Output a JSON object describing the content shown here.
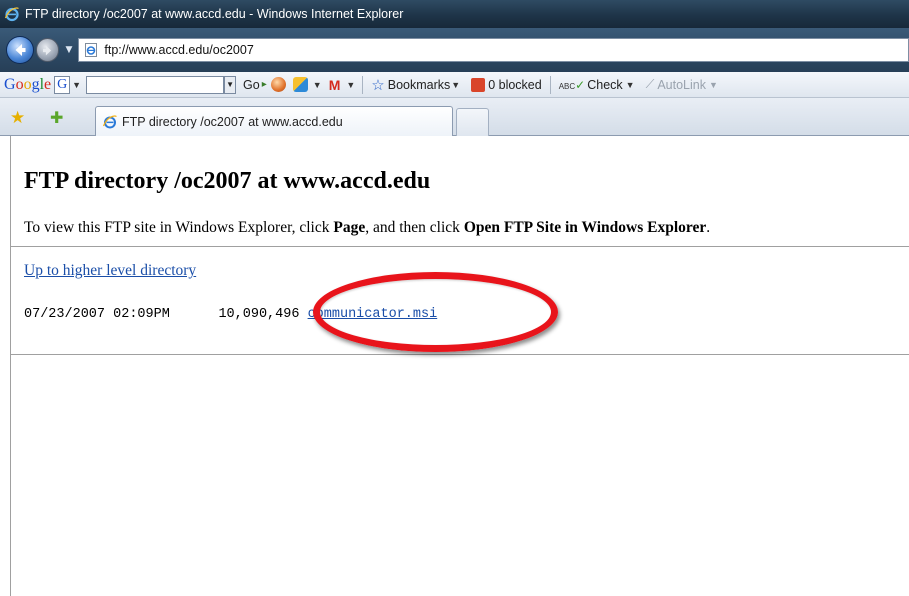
{
  "window": {
    "title": "FTP directory /oc2007 at www.accd.edu - Windows Internet Explorer"
  },
  "address_bar": {
    "url": "ftp://www.accd.edu/oc2007"
  },
  "toolbar": {
    "google_logo": "Google",
    "g_button": "G",
    "go_label": "Go",
    "bookmarks_label": "Bookmarks",
    "blocked_label": "0 blocked",
    "check_label": "Check",
    "autolink_label": "AutoLink"
  },
  "tabs": [
    {
      "label": "FTP directory /oc2007 at www.accd.edu"
    }
  ],
  "page": {
    "heading": "FTP directory /oc2007 at www.accd.edu",
    "instruction_prefix": "To view this FTP site in Windows Explorer, click ",
    "instruction_page": "Page",
    "instruction_middle": ", and then click ",
    "instruction_action": "Open FTP Site in Windows Explorer",
    "instruction_suffix": ".",
    "up_link": "Up to higher level directory",
    "files": [
      {
        "date": "07/23/2007",
        "time": "02:09PM",
        "size": "10,090,496",
        "name": "communicator.msi"
      }
    ]
  },
  "colors": {
    "link": "#1a4ea8",
    "highlight": "#e8141b"
  }
}
